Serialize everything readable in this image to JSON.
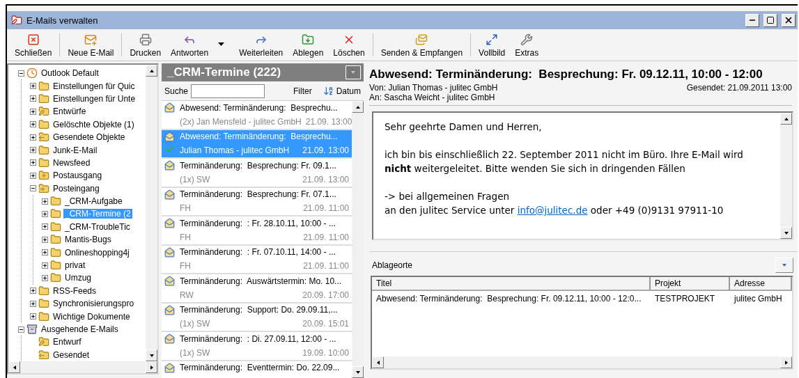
{
  "window": {
    "title": "E-Mails verwalten"
  },
  "toolbar_groups": [
    [
      {
        "label": "Schließen",
        "kind": "close",
        "dropdown": false
      }
    ],
    [
      {
        "label": "Neue E-Mail",
        "kind": "new",
        "dropdown": false
      }
    ],
    [
      {
        "label": "Drucken",
        "kind": "print",
        "dropdown": false
      },
      {
        "label": "Antworten",
        "kind": "reply",
        "dropdown": true
      },
      {
        "label": "Weiterleiten",
        "kind": "forward",
        "dropdown": false
      },
      {
        "label": "Ablegen",
        "kind": "file",
        "dropdown": false
      },
      {
        "label": "Löschen",
        "kind": "delete",
        "dropdown": false
      }
    ],
    [
      {
        "label": "Senden & Empfangen",
        "kind": "sendreceive",
        "dropdown": false
      }
    ],
    [
      {
        "label": "Vollbild",
        "kind": "fullscreen",
        "dropdown": false
      },
      {
        "label": "Extras",
        "kind": "tools",
        "dropdown": false
      }
    ]
  ],
  "folder_tree": [
    {
      "label": "Outlook Default",
      "kind": "account",
      "expanded": true,
      "selected": false,
      "children": [
        {
          "label": "Einstellungen für Quic",
          "kind": "folder",
          "expanded": false,
          "selected": false
        },
        {
          "label": "Einstellungen für Unte",
          "kind": "folder",
          "expanded": false,
          "selected": false
        },
        {
          "label": "Entwürfe",
          "kind": "drafts",
          "expanded": false,
          "selected": false
        },
        {
          "label": "Gelöschte Objekte (1)",
          "kind": "folder",
          "expanded": false,
          "selected": false
        },
        {
          "label": "Gesendete Objekte",
          "kind": "sent",
          "expanded": false,
          "selected": false
        },
        {
          "label": "Junk-E-Mail",
          "kind": "folder",
          "expanded": false,
          "selected": false
        },
        {
          "label": "Newsfeed",
          "kind": "folder",
          "expanded": false,
          "selected": false
        },
        {
          "label": "Postausgang",
          "kind": "outbox",
          "expanded": false,
          "selected": false
        },
        {
          "label": "Posteingang",
          "kind": "inbox",
          "expanded": true,
          "selected": false,
          "children": [
            {
              "label": "_CRM-Aufgabe",
              "kind": "folder",
              "expanded": false,
              "selected": false
            },
            {
              "label": "_CRM-Termine (2",
              "kind": "folder",
              "expanded": false,
              "selected": true
            },
            {
              "label": "_CRM-TroubleTic",
              "kind": "folder",
              "expanded": false,
              "selected": false
            },
            {
              "label": "Mantis-Bugs",
              "kind": "folder",
              "expanded": false,
              "selected": false
            },
            {
              "label": "Onlineshopping4j",
              "kind": "folder",
              "expanded": false,
              "selected": false
            },
            {
              "label": "privat",
              "kind": "folder",
              "expanded": false,
              "selected": false
            },
            {
              "label": "Umzug",
              "kind": "folder",
              "expanded": false,
              "selected": false
            }
          ]
        },
        {
          "label": "RSS-Feeds",
          "kind": "folder",
          "expanded": false,
          "selected": false
        },
        {
          "label": "Synchronisierungspro",
          "kind": "folder",
          "expanded": false,
          "selected": false
        },
        {
          "label": "Wichtige Dokumente",
          "kind": "folder",
          "expanded": false,
          "selected": false
        }
      ]
    },
    {
      "label": "Ausgehende E-Mails",
      "kind": "outgoing",
      "expanded": true,
      "selected": false,
      "children": [
        {
          "label": "Entwurf",
          "kind": "drafts",
          "selected": false
        },
        {
          "label": "Gesendet",
          "kind": "sent",
          "selected": false
        }
      ]
    }
  ],
  "message_list": {
    "title": "_CRM-Termine (222)",
    "search_label": "Suche",
    "filter": "Filter",
    "sort": "Datum",
    "messages": [
      {
        "subject": "Abwesend: Terminänderung:  Besprechu...",
        "from": "(2x) Jan Mensfeld - julitec GmbH",
        "date": "21.09. 13:00",
        "selected": false,
        "checked": false
      },
      {
        "subject": "Abwesend: Terminänderung:  Besprechu...",
        "from": "Julian Thomas - julitec GmbH",
        "date": "21.09. 13:00",
        "selected": true,
        "checked": true
      },
      {
        "subject": "Terminänderung:  Besprechung: Fr. 09.1...",
        "from": "(1x) SW",
        "date": "21.09. 13:00",
        "selected": false,
        "checked": false
      },
      {
        "subject": "Terminänderung:  Besprechung: Fr. 07.1...",
        "from": "FH",
        "date": "21.09. 11:00",
        "selected": false,
        "checked": false
      },
      {
        "subject": "Terminänderung:  : Fr. 28.10.11, 10:00 - ...",
        "from": "FH",
        "date": "21.09. 11:00",
        "selected": false,
        "checked": false
      },
      {
        "subject": "Terminänderung:  : Fr. 07.10.11, 14:00 - ...",
        "from": "FH",
        "date": "21.09. 11:00",
        "selected": false,
        "checked": false
      },
      {
        "subject": "Terminänderung:  Auswärtstermin: Mo. 10...",
        "from": "RW",
        "date": "20.09. 17:00",
        "selected": false,
        "checked": false
      },
      {
        "subject": "Terminänderung:  Support: Do. 29.09.11,...",
        "from": "(1x) SW",
        "date": "20.09. 15:01",
        "selected": false,
        "checked": false
      },
      {
        "subject": "Terminänderung:  : Di. 27.09.11, 12:00 - ...",
        "from": "(1x) SW",
        "date": "19.09. 10:00",
        "selected": false,
        "checked": false
      },
      {
        "subject": "Terminänderung:  Eventtermin: Do. 22.09...",
        "selected": false,
        "checked": false
      }
    ]
  },
  "reading_pane": {
    "subject": "Abwesend: Terminänderung:  Besprechung: Fr. 09.12.11, 10:00 - 12:00",
    "from": "Von: Julian Thomas - julitec GmbH",
    "sent": "Gesendet: 21.09.2011 13:00",
    "to": "An: Sascha Weicht - julitec GmbH",
    "body": [
      {
        "text": "Sehr geehrte Damen und Herren,",
        "gap_before": false
      },
      {
        "text": "ich bin bis einschließlich 22. September 2011 nicht im Büro. Ihre E-Mail wird **nicht** weitergeleitet. Bitte wenden Sie sich in dringenden Fällen",
        "gap_before": true
      },
      {
        "text": "-> bei allgemeinen Fragen",
        "gap_before": true
      },
      {
        "text": "an den julitec Service unter ",
        "link": "info@julitec.de",
        "after": " oder +49 (0)9131 97911-10",
        "gap_before": false
      }
    ]
  },
  "filing": {
    "title": "Ablageorte",
    "columns": [
      "Titel",
      "Projekt",
      "Adresse"
    ],
    "rows": [
      [
        "Abwesend: Terminänderung:  Besprechung: Fr. 09.12.11, 10:00 - 12:0...",
        "TESTPROJEKT",
        "julitec GmbH"
      ]
    ]
  }
}
